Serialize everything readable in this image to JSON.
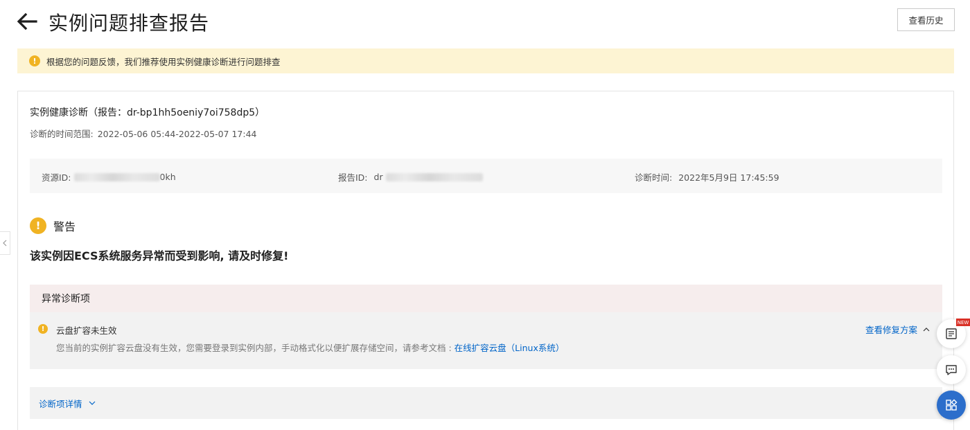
{
  "header": {
    "title": "实例问题排查报告",
    "history_button": "查看历史"
  },
  "notice": {
    "text": "根据您的问题反馈，我们推荐使用实例健康诊断进行问题排查"
  },
  "report": {
    "title": "实例健康诊断（报告：dr-bp1hh5oeniy7oi758dp5）",
    "time_range_label": "诊断的时间范围:",
    "time_range_value": "2022-05-06 05:44-2022-05-07 17:44",
    "resource_id_label": "资源ID:",
    "resource_id_visible_suffix": "0kh",
    "report_id_label": "报告ID:",
    "report_id_visible_prefix": "dr",
    "diagnosis_time_label": "诊断时间:",
    "diagnosis_time_value": "2022年5月9日 17:45:59"
  },
  "warning": {
    "label": "警告",
    "message": "该实例因ECS系统服务异常而受到影响, 请及时修复!"
  },
  "abnormal": {
    "header": "异常诊断项",
    "item": {
      "title": "云盘扩容未生效",
      "fix_link": "查看修复方案",
      "description": "您当前的实例扩容云盘没有生效，您需要登录到实例内部，手动格式化以便扩展存储空间，请参考文档 : ",
      "doc_link": "在线扩容云盘（Linux系统）"
    }
  },
  "details": {
    "toggle_label": "诊断项详情"
  },
  "floating": {
    "new_badge": "NEW"
  },
  "colors": {
    "warning": "#f0b323",
    "link": "#0064c8",
    "notice_bg": "#fdf4d3",
    "abnormal_header_bg": "#f6eded",
    "float_blue": "#2c6ecb",
    "badge_red": "#d93026"
  },
  "icons": {
    "back": "arrow-left-icon",
    "notice": "warning-circle-icon",
    "fix_toggle": "chevron-up-icon",
    "details_toggle": "chevron-down-icon",
    "side": "chevron-left-icon",
    "float_1": "book-icon",
    "float_2": "chat-bubble-icon",
    "float_3": "apps-grid-icon"
  }
}
